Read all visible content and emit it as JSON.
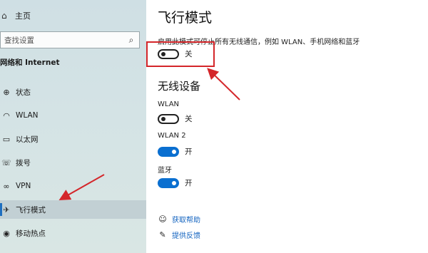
{
  "sidebar": {
    "home_label": "主页",
    "search_placeholder": "查找设置",
    "section_title": "网络和 Internet",
    "items": [
      {
        "label": "状态",
        "icon": "status-icon"
      },
      {
        "label": "WLAN",
        "icon": "wifi-icon"
      },
      {
        "label": "以太网",
        "icon": "ethernet-icon"
      },
      {
        "label": "拨号",
        "icon": "dialup-icon"
      },
      {
        "label": "VPN",
        "icon": "vpn-icon"
      },
      {
        "label": "飞行模式",
        "icon": "airplane-icon",
        "active": true
      },
      {
        "label": "移动热点",
        "icon": "hotspot-icon"
      }
    ]
  },
  "main": {
    "title": "飞行模式",
    "description": "启用此模式可停止所有无线通信，例如 WLAN、手机网络和蓝牙",
    "airplane_toggle": {
      "state_label": "关",
      "on": false
    },
    "wireless_heading": "无线设备",
    "devices": [
      {
        "name": "WLAN",
        "state_label": "关",
        "on": false
      },
      {
        "name": "WLAN 2",
        "state_label": "开",
        "on": true
      },
      {
        "name": "蓝牙",
        "state_label": "开",
        "on": true
      }
    ],
    "links": [
      {
        "label": "获取帮助",
        "icon": "help-icon"
      },
      {
        "label": "提供反馈",
        "icon": "feedback-icon"
      }
    ]
  },
  "colors": {
    "accent": "#0a6fd0",
    "annotation": "#d4262a",
    "link": "#1565c0"
  }
}
